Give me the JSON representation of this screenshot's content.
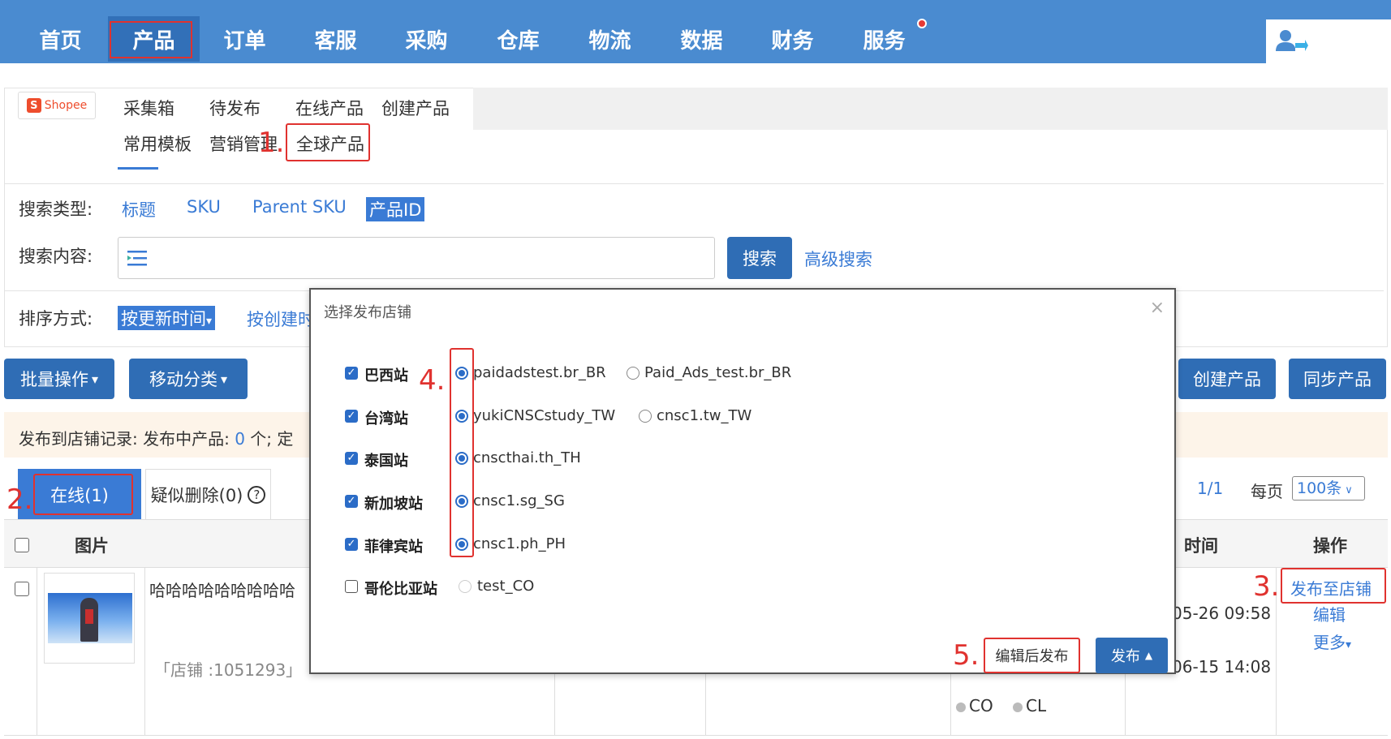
{
  "nav": {
    "items": [
      "首页",
      "产品",
      "订单",
      "客服",
      "采购",
      "仓库",
      "物流",
      "数据",
      "财务",
      "服务"
    ],
    "active": "产品"
  },
  "platform": {
    "logo": "Shopee"
  },
  "subtabs": {
    "row1": [
      "采集箱",
      "待发布",
      "在线产品",
      "创建产品"
    ],
    "row2": [
      "常用模板",
      "营销管理",
      "全球产品"
    ]
  },
  "annotations": [
    "1.",
    "2.",
    "3.",
    "4.",
    "5."
  ],
  "search": {
    "type_label": "搜索类型:",
    "types": [
      "标题",
      "SKU",
      "Parent SKU",
      "产品ID"
    ],
    "active_type": "产品ID",
    "content_label": "搜索内容:",
    "search_button": "搜索",
    "advanced": "高级搜索"
  },
  "sort": {
    "label": "排序方式:",
    "active": "按更新时间",
    "other": "按创建时"
  },
  "actions": {
    "batch": "批量操作",
    "move": "移动分类",
    "create": "创建产品",
    "sync": "同步产品"
  },
  "notice": {
    "text": "发布到店铺记录:  发布中产品:",
    "count": "0",
    "suffix": "个;  定"
  },
  "tabs": {
    "online": "在线(1)",
    "suspect": "疑似删除(0)",
    "help_icon": "?"
  },
  "pager": {
    "page": "1/1",
    "per_page_label": "每页",
    "per_page": "100条"
  },
  "table": {
    "headers": {
      "image": "图片",
      "time": "时间",
      "ops": "操作"
    },
    "row": {
      "title": "哈哈哈哈哈哈哈哈哈",
      "store": "「店铺 :1051293」",
      "time1": "05-26 09:58",
      "time2": "06-15 14:08",
      "sites": [
        "CO",
        "CL"
      ],
      "ops": {
        "publish": "发布至店铺",
        "edit": "编辑",
        "more": "更多"
      }
    }
  },
  "modal": {
    "title": "选择发布店铺",
    "close": "×",
    "sites": [
      {
        "label": "巴西站",
        "checked": true,
        "shops": [
          {
            "name": "paidadstest.br_BR",
            "selected": true
          },
          {
            "name": "Paid_Ads_test.br_BR",
            "selected": false
          }
        ]
      },
      {
        "label": "台湾站",
        "checked": true,
        "shops": [
          {
            "name": "yukiCNSCstudy_TW",
            "selected": true
          },
          {
            "name": "cnsc1.tw_TW",
            "selected": false
          }
        ]
      },
      {
        "label": "泰国站",
        "checked": true,
        "shops": [
          {
            "name": "cnscthai.th_TH",
            "selected": true
          }
        ]
      },
      {
        "label": "新加坡站",
        "checked": true,
        "shops": [
          {
            "name": "cnsc1.sg_SG",
            "selected": true
          }
        ]
      },
      {
        "label": "菲律宾站",
        "checked": true,
        "shops": [
          {
            "name": "cnsc1.ph_PH",
            "selected": true
          }
        ]
      },
      {
        "label": "哥伦比亚站",
        "checked": false,
        "shops": [
          {
            "name": "test_CO",
            "selected": false
          }
        ]
      }
    ],
    "edit_publish": "编辑后发布",
    "publish": "发布"
  },
  "colors": {
    "nav_bg": "#4a8bd0",
    "accent": "#3a7bd5",
    "annotation": "#e0322f"
  }
}
